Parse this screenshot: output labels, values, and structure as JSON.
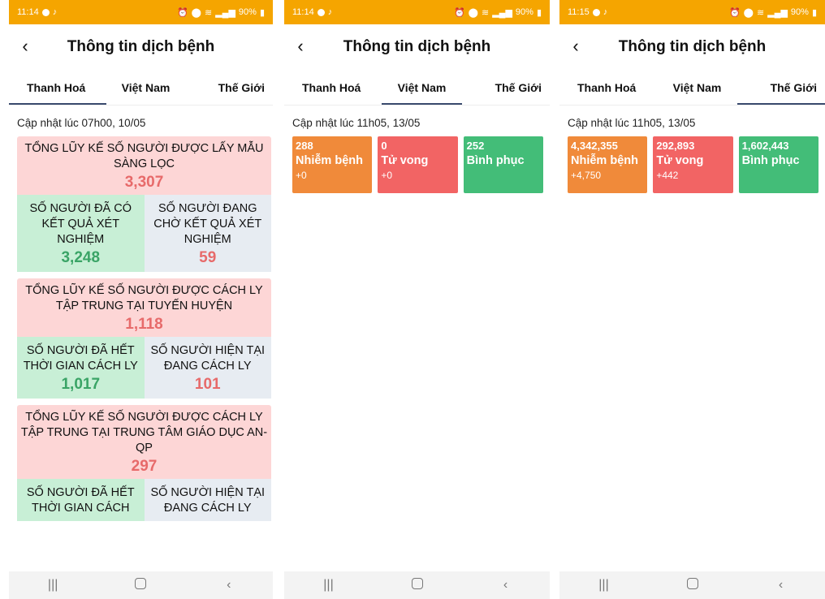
{
  "colors": {
    "status_bar": "#f5a500",
    "pink": "#fdd6d6",
    "green": "#c8efd6",
    "grey": "#e7ecf2",
    "red_num": "#e76a6a",
    "green_num": "#3aa466",
    "infected": "#f08a3a",
    "deaths": "#f26464",
    "recovered": "#43bd78"
  },
  "screens": [
    {
      "status": {
        "time": "11:14",
        "battery": "90%"
      },
      "title": "Thông tin dịch bệnh",
      "tabs": [
        "Thanh Hoá",
        "Việt Nam",
        "Thế Giới"
      ],
      "updated": "Cập nhật lúc 07h00, 10/05",
      "sections": [
        {
          "title": "TỔNG LŨY KẾ SỐ NGƯỜI ĐƯỢC LẤY MẪU SÀNG LỌC",
          "value": "3,307",
          "left_label": "SỐ NGƯỜI ĐÃ CÓ KẾT QUẢ XÉT NGHIỆM",
          "left_value": "3,248",
          "right_label": "SỐ NGƯỜI ĐANG CHỜ KẾT QUẢ XÉT NGHIỆM",
          "right_value": "59"
        },
        {
          "title": "TỔNG LŨY KẾ SỐ NGƯỜI  ĐƯỢC CÁCH LY TẬP TRUNG TẠI TUYẾN HUYỆN",
          "value": "1,118",
          "left_label": "SỐ NGƯỜI ĐÃ HẾT THỜI GIAN CÁCH LY",
          "left_value": "1,017",
          "right_label": "SỐ NGƯỜI HIỆN TẠI ĐANG CÁCH LY",
          "right_value": "101"
        },
        {
          "title": "TỔNG LŨY KẾ  SỐ NGƯỜI ĐƯỢC CÁCH LY TẬP TRUNG TẠI TRUNG TÂM GIÁO DỤC AN-QP",
          "value": "297",
          "left_label": "SỐ NGƯỜI ĐÃ HẾT THỜI GIAN CÁCH",
          "left_value": "",
          "right_label": "SỐ NGƯỜI HIỆN TẠI ĐANG CÁCH LY",
          "right_value": ""
        }
      ]
    },
    {
      "status": {
        "time": "11:14",
        "battery": "90%"
      },
      "title": "Thông tin dịch bệnh",
      "tabs": [
        "Thanh Hoá",
        "Việt Nam",
        "Thế Giới"
      ],
      "updated": "Cập nhật lúc 11h05, 13/05",
      "stats": [
        {
          "value": "288",
          "label": "Nhiễm bệnh",
          "delta": "+0"
        },
        {
          "value": "0",
          "label": "Tử vong",
          "delta": "+0"
        },
        {
          "value": "252",
          "label": "Bình phục",
          "delta": ""
        }
      ]
    },
    {
      "status": {
        "time": "11:15",
        "battery": "90%"
      },
      "title": "Thông tin dịch bệnh",
      "tabs": [
        "Thanh Hoá",
        "Việt Nam",
        "Thế Giới"
      ],
      "updated": "Cập nhật lúc 11h05, 13/05",
      "stats": [
        {
          "value": "4,342,355",
          "label": "Nhiễm bệnh",
          "delta": "+4,750"
        },
        {
          "value": "292,893",
          "label": "Tử vong",
          "delta": "+442"
        },
        {
          "value": "1,602,443",
          "label": "Bình phục",
          "delta": ""
        }
      ]
    }
  ],
  "navbar": {
    "recents": "|||",
    "back": "‹"
  },
  "icons": [
    "wifi-icon",
    "signal-icon",
    "battery-icon",
    "alarm-icon",
    "location-icon",
    "back-arrow-icon"
  ]
}
